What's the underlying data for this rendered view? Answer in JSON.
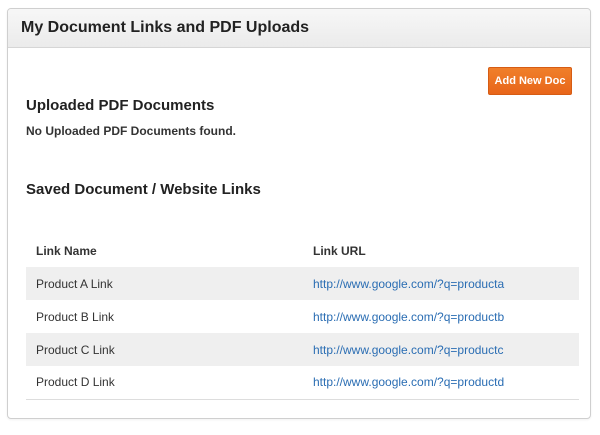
{
  "panel": {
    "title": "My Document Links and PDF Uploads",
    "add_button_label": "Add New Doc"
  },
  "pdf_section": {
    "heading": "Uploaded PDF Documents",
    "empty_message": "No Uploaded PDF Documents found."
  },
  "links_section": {
    "heading": "Saved Document / Website Links",
    "columns": [
      "Link Name",
      "Link URL"
    ],
    "rows": [
      {
        "name": "Product A Link",
        "url": "http://www.google.com/?q=producta"
      },
      {
        "name": "Product B Link",
        "url": "http://www.google.com/?q=productb"
      },
      {
        "name": "Product C Link",
        "url": "http://www.google.com/?q=productc"
      },
      {
        "name": "Product D Link",
        "url": "http://www.google.com/?q=productd"
      }
    ]
  },
  "colors": {
    "accent_button": "#e8661a",
    "link": "#2a6db3"
  }
}
